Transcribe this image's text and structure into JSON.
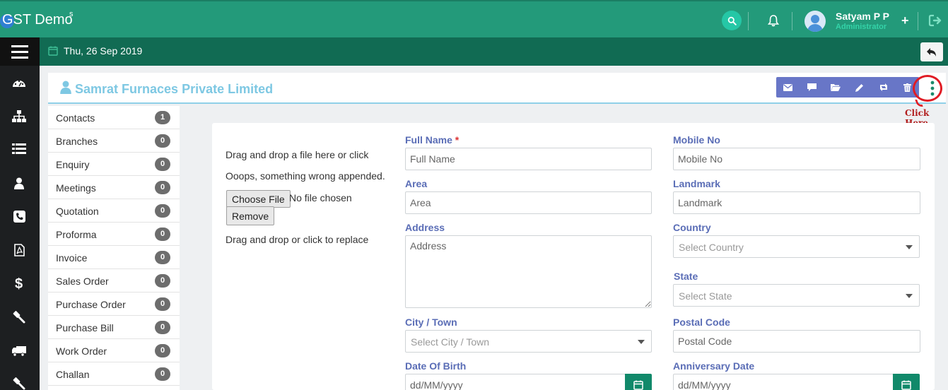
{
  "app": {
    "brand": "GST Demo",
    "brand_sup": "s",
    "brand_color": "#239a7a"
  },
  "header": {
    "search_icon": "search-icon",
    "bell_icon": "bell-icon",
    "user_name": "Satyam P P",
    "user_role": "Administrator",
    "plus_label": "+",
    "logout_icon": "logout-icon"
  },
  "subbar": {
    "date": "Thu, 26 Sep 2019",
    "calendar_icon": "calendar-icon",
    "back_icon": "reply-icon"
  },
  "sidebar": {
    "icons": [
      "dashboard-icon",
      "sitemap-icon",
      "list-icon",
      "user-icon",
      "phone-icon",
      "pdf-icon",
      "dollar-icon",
      "gavel-icon",
      "truck-icon",
      "hammer-icon"
    ]
  },
  "title_row": {
    "company": "Samrat Furnaces Private Limited",
    "toolbar_icons": [
      "envelope-icon",
      "comment-icon",
      "folder-icon",
      "pencil-icon",
      "retweet-icon",
      "trash-icon"
    ],
    "kebab_icon": "more-vertical-icon",
    "annotation": "Click Here",
    "annotation_color": "#e01b24"
  },
  "modules": [
    {
      "label": "Contacts",
      "count": "1"
    },
    {
      "label": "Branches",
      "count": "0"
    },
    {
      "label": "Enquiry",
      "count": "0"
    },
    {
      "label": "Meetings",
      "count": "0"
    },
    {
      "label": "Quotation",
      "count": "0"
    },
    {
      "label": "Proforma",
      "count": "0"
    },
    {
      "label": "Invoice",
      "count": "0"
    },
    {
      "label": "Sales Order",
      "count": "0"
    },
    {
      "label": "Purchase Order",
      "count": "0"
    },
    {
      "label": "Purchase Bill",
      "count": "0"
    },
    {
      "label": "Work Order",
      "count": "0"
    },
    {
      "label": "Challan",
      "count": "0"
    }
  ],
  "upload": {
    "drag_text": "Drag and drop a file here or click",
    "error_text": "Ooops, something wrong appended.",
    "choose_label": "Choose File",
    "no_file": "No file chosen",
    "remove_label": "Remove",
    "replace_text": "Drag and drop or click to replace"
  },
  "form": {
    "full_name": {
      "label": "Full Name",
      "required": "*",
      "placeholder": "Full Name"
    },
    "mobile": {
      "label": "Mobile No",
      "placeholder": "Mobile No"
    },
    "area": {
      "label": "Area",
      "placeholder": "Area"
    },
    "landmark": {
      "label": "Landmark",
      "placeholder": "Landmark"
    },
    "address": {
      "label": "Address",
      "placeholder": "Address"
    },
    "country": {
      "label": "Country",
      "placeholder": "Select Country"
    },
    "state": {
      "label": "State",
      "placeholder": "Select State"
    },
    "city": {
      "label": "City / Town",
      "placeholder": "Select City / Town"
    },
    "postal": {
      "label": "Postal Code",
      "placeholder": "Postal Code"
    },
    "dob": {
      "label": "Date Of Birth",
      "placeholder": "dd/MM/yyyy"
    },
    "anniversary": {
      "label": "Anniversary Date",
      "placeholder": "dd/MM/yyyy"
    }
  }
}
